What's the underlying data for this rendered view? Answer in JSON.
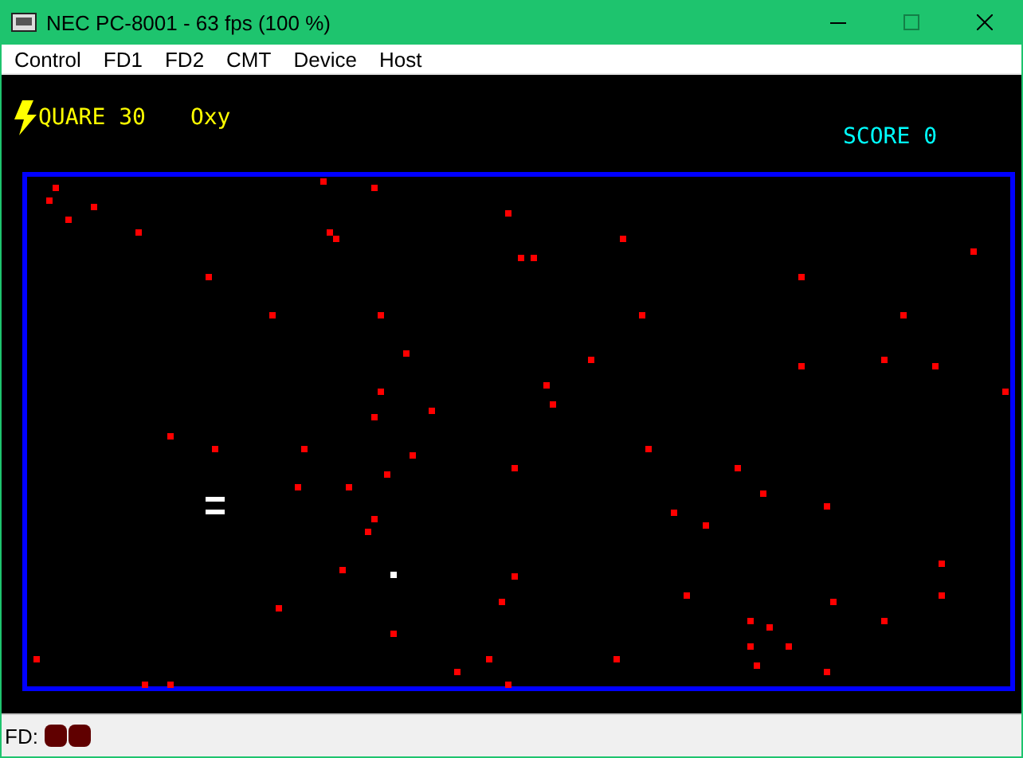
{
  "window": {
    "title": "NEC PC-8001 - 63 fps (100 %)",
    "maximize_disabled": true
  },
  "menu": [
    "Control",
    "FD1",
    "FD2",
    "CMT",
    "Device",
    "Host"
  ],
  "screen": {
    "title": "QUARE 30",
    "label": "Oxy",
    "score": "SCORE 0"
  },
  "status_bar": {
    "label": "FD:",
    "drives": [
      {
        "lit": false
      },
      {
        "lit": false
      }
    ]
  }
}
